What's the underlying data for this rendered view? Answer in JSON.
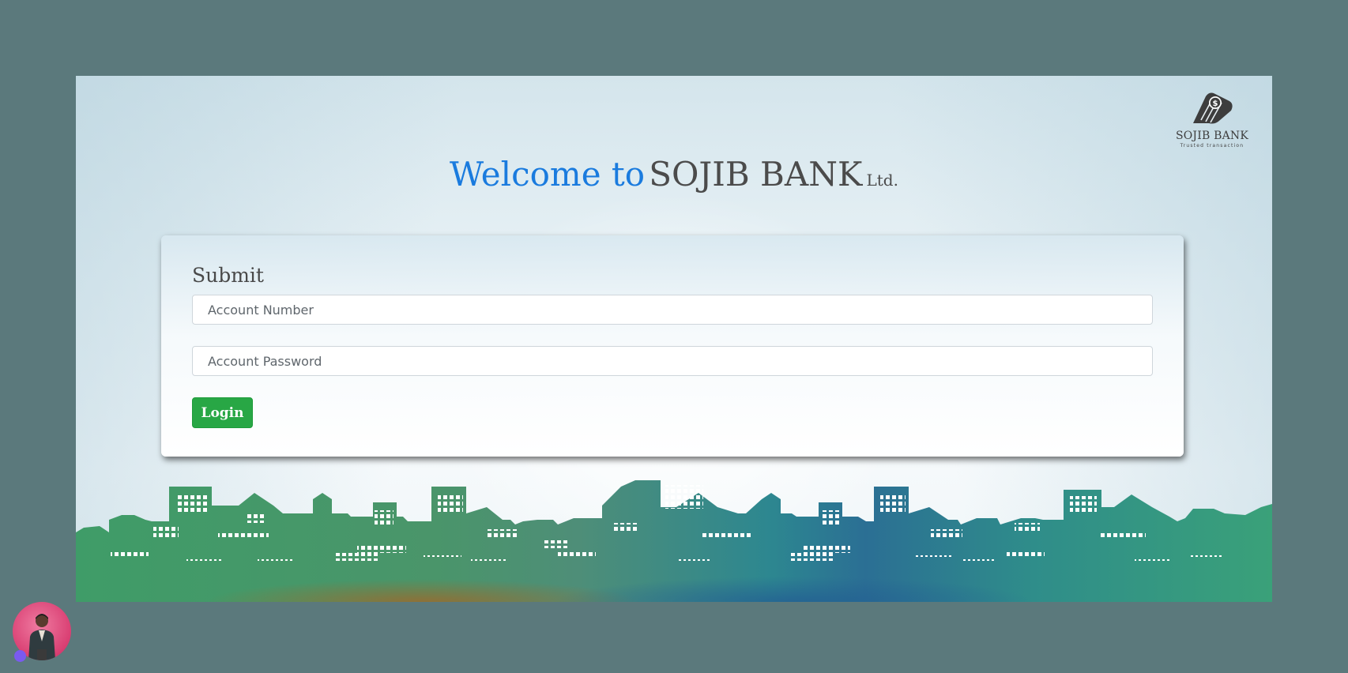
{
  "brand": {
    "logo_name": "SOJIB BANK",
    "logo_tagline": "Trusted transaction",
    "logo_icon": "money-bag-icon"
  },
  "headline": {
    "welcome": "Welcome to",
    "bank_name": "SOJIB BANK",
    "suffix": "Ltd."
  },
  "form": {
    "title": "Submit",
    "account_number": {
      "placeholder": "Account Number",
      "value": ""
    },
    "account_password": {
      "placeholder": "Account Password",
      "value": ""
    },
    "login_label": "Login"
  },
  "colors": {
    "page_bg": "#5b797c",
    "welcome_blue": "#1a7bde",
    "login_green": "#28a745",
    "skyline_green": "#3f9c68",
    "skyline_teal": "#2b7f8e"
  },
  "decorations": {
    "skyline": "city-skyline-illustration",
    "avatar": "user-avatar"
  }
}
